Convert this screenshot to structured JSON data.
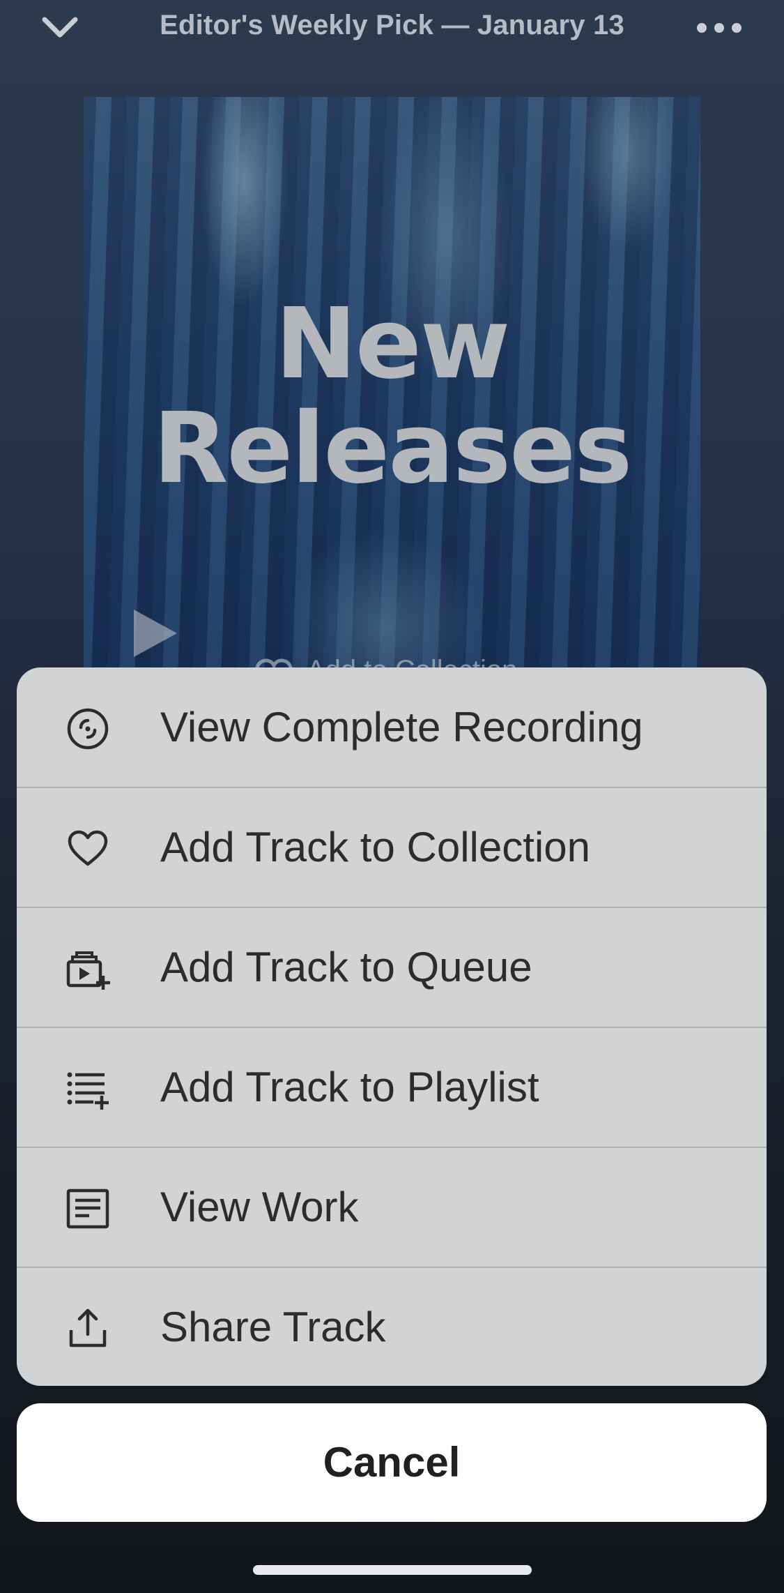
{
  "header": {
    "title": "Editor's Weekly Pick — January 13"
  },
  "artwork": {
    "line1": "New",
    "line2": "Releases",
    "behind_label": "Add to Collection"
  },
  "action_sheet": {
    "items": [
      {
        "label": "View Complete Recording",
        "icon": "recording-icon"
      },
      {
        "label": "Add Track to Collection",
        "icon": "heart-icon"
      },
      {
        "label": "Add Track to Queue",
        "icon": "queue-icon"
      },
      {
        "label": "Add Track to Playlist",
        "icon": "playlist-add-icon"
      },
      {
        "label": "View Work",
        "icon": "document-icon"
      },
      {
        "label": "Share Track",
        "icon": "share-icon"
      }
    ],
    "cancel_label": "Cancel"
  },
  "colors": {
    "sheet_bg": "#d1d3d5",
    "text": "#2b2c2e",
    "cancel_bg": "#ffffff"
  }
}
